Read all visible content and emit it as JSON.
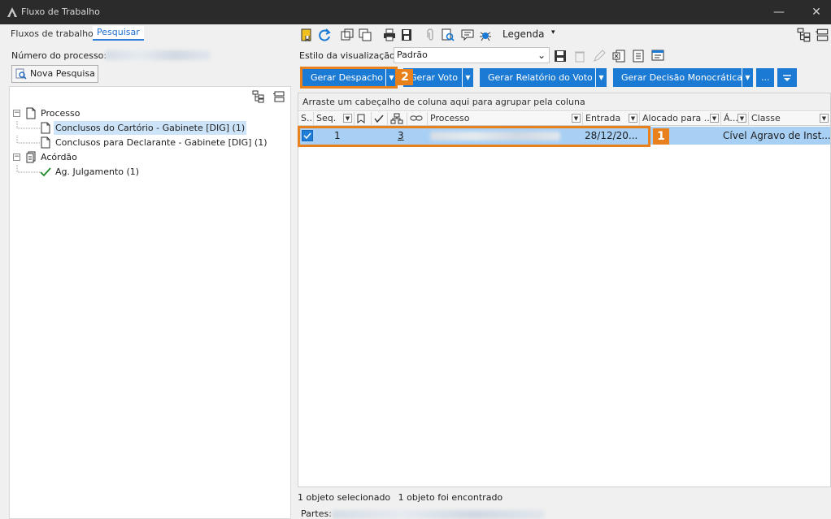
{
  "window": {
    "title": "Fluxo de Trabalho",
    "minimize_glyph": "—",
    "close_glyph": "✕"
  },
  "left_tabs": [
    {
      "label": "Fluxos de trabalho",
      "active": false
    },
    {
      "label": "Pesquisar",
      "active": true
    }
  ],
  "search": {
    "process_number_label": "Número do processo:",
    "new_search_button": "Nova Pesquisa"
  },
  "tree": [
    {
      "label": "Processo",
      "level": 0,
      "expand": "−",
      "icon": "document-icon"
    },
    {
      "label": "Conclusos do Cartório - Gabinete [DIG] (1)",
      "level": 1,
      "selected": true,
      "icon": "document-icon"
    },
    {
      "label": "Conclusos para Declarante - Gabinete [DIG] (1)",
      "level": 1,
      "icon": "document-icon"
    },
    {
      "label": "Acórdão",
      "level": 0,
      "expand": "−",
      "icon": "documents-stack-icon"
    },
    {
      "label": "Ag. Julgamento (1)",
      "level": 1,
      "icon": "check-icon"
    }
  ],
  "toolbar": {
    "legend_label": "Legenda",
    "legend_dropdown": "▾"
  },
  "view_style": {
    "label": "Estilo da visualização",
    "value": "Padrão"
  },
  "actions": [
    {
      "label": "Gerar Despacho"
    },
    {
      "label": "Gerar Voto"
    },
    {
      "label": "Gerar Relatório do Voto"
    },
    {
      "label": "Gerar Decisão Monocrática"
    },
    {
      "label": "..."
    }
  ],
  "annotations": {
    "marker_1": "1",
    "marker_2": "2"
  },
  "grid": {
    "group_hint": "Arraste um cabeçalho de coluna aqui para agrupar pela coluna",
    "columns": [
      "S...",
      "Seq.",
      "",
      "",
      "",
      "",
      "Processo",
      "Entrada",
      "Alocado para ...",
      "Á...",
      "Classe"
    ],
    "rows": [
      {
        "seq": "1",
        "count": "3",
        "entrada": "28/12/20...",
        "area": "Cível",
        "classe": "Agravo de Inst..."
      }
    ]
  },
  "status": {
    "selected": "1 objeto selecionado",
    "found": "1 objeto foi encontrado",
    "partes_label": "Partes:"
  },
  "colors": {
    "accent": "#1a7ad4",
    "highlight": "#e8801c",
    "selection_row": "#a8d0f4",
    "titlebar": "#2b2b2b"
  }
}
